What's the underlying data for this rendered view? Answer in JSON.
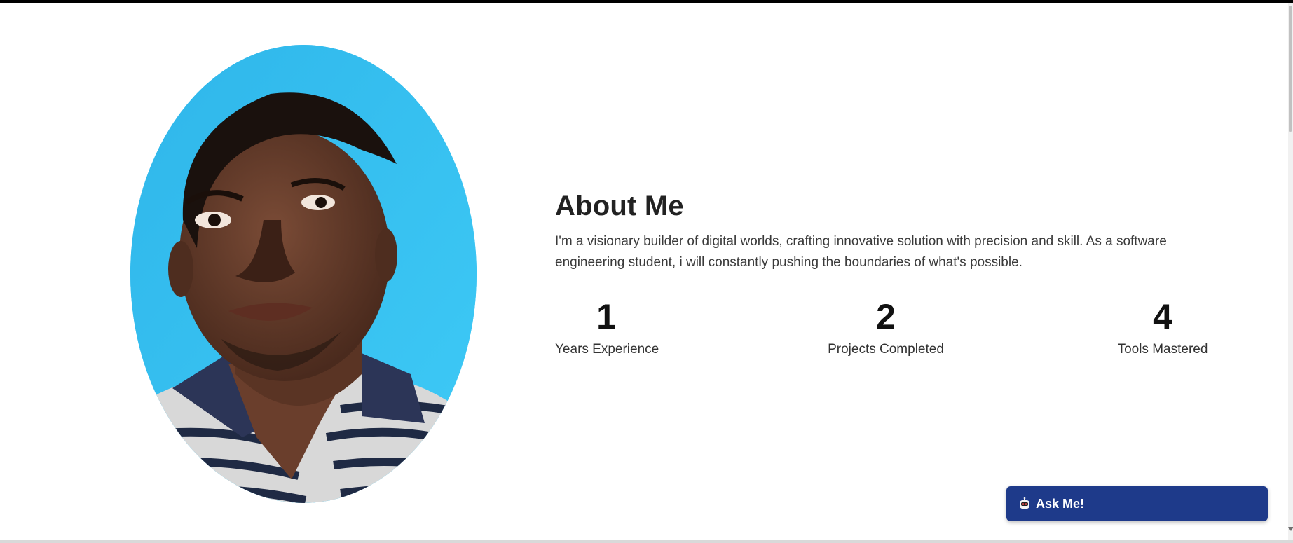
{
  "about": {
    "title": "About Me",
    "description": "I'm a visionary builder of digital worlds, crafting innovative solution with precision and skill. As a software engineering student, i will constantly pushing the boundaries of what's possible."
  },
  "stats": [
    {
      "value": "1",
      "label": "Years Experience"
    },
    {
      "value": "2",
      "label": "Projects Completed"
    },
    {
      "value": "4",
      "label": "Tools Mastered"
    }
  ],
  "chat": {
    "label": "Ask Me!",
    "icon": "robot-icon"
  },
  "colors": {
    "accent": "#1e3a8a",
    "portrait_bg": "#33bdf0",
    "heading": "#222222",
    "body_text": "#3a3a3a"
  }
}
